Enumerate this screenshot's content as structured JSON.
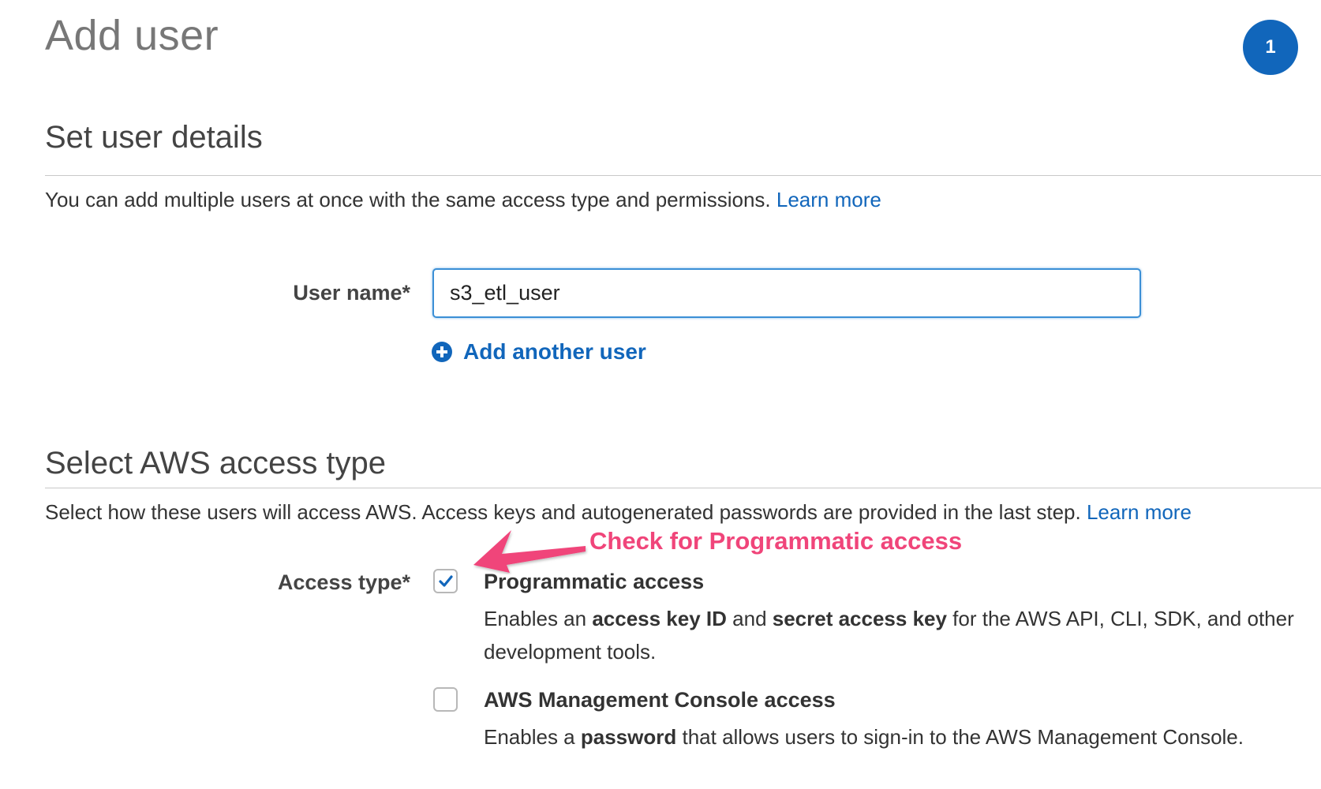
{
  "header": {
    "title": "Add user",
    "step_number": "1"
  },
  "user_details": {
    "title": "Set user details",
    "description": "You can add multiple users at once with the same access type and permissions.",
    "learn_more": "Learn more",
    "username_label": "User name*",
    "username_value": "s3_etl_user",
    "add_another_label": "Add another user"
  },
  "access_type": {
    "title": "Select AWS access type",
    "description": "Select how these users will access AWS. Access keys and autogenerated passwords are provided in the last step.",
    "learn_more": "Learn more",
    "label": "Access type*",
    "options": [
      {
        "title": "Programmatic access",
        "checked": true,
        "desc_1": "Enables an ",
        "desc_bold_1": "access key ID",
        "desc_2": " and ",
        "desc_bold_2": "secret access key",
        "desc_3": " for the AWS API, CLI, SDK, and other development tools."
      },
      {
        "title": "AWS Management Console access",
        "checked": false,
        "desc_1": "Enables a ",
        "desc_bold_1": "password",
        "desc_2": " that allows users to sign-in to the AWS Management Console."
      }
    ]
  },
  "annotation": {
    "text": "Check for Programmatic access",
    "color": "#f0457a"
  },
  "colors": {
    "accent": "#1166bb",
    "title_gray": "#777777"
  }
}
